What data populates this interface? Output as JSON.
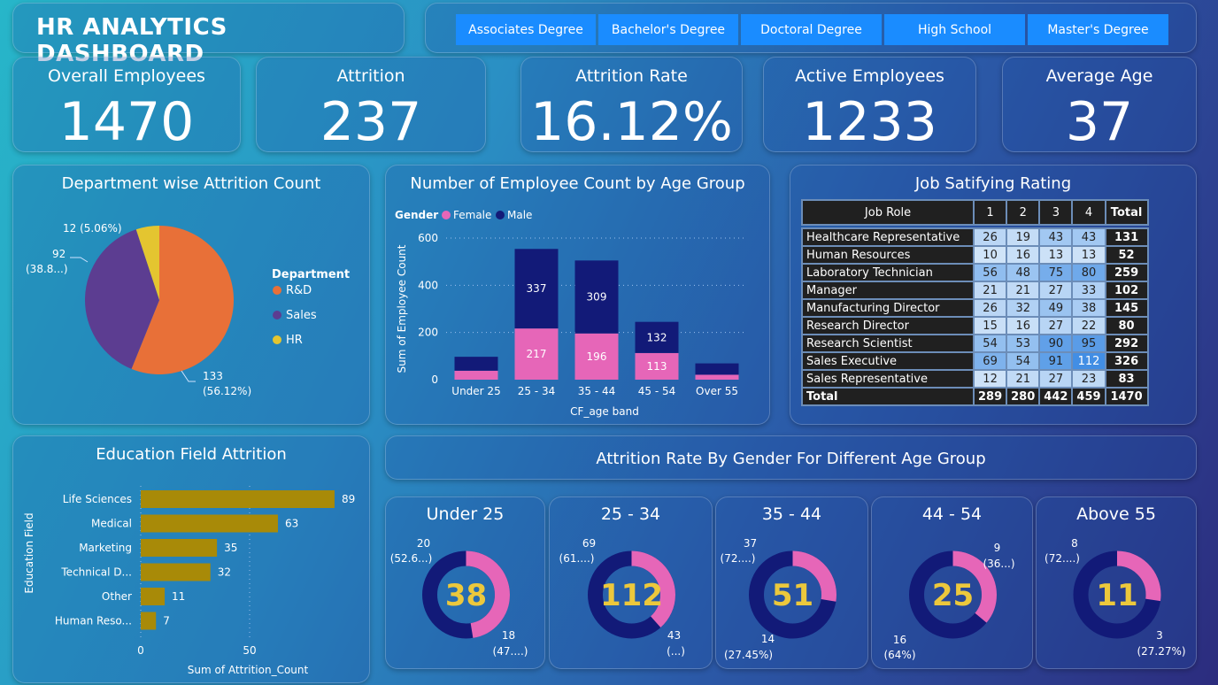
{
  "header": {
    "title": "HR ANALYTICS DASHBOARD"
  },
  "filters": [
    "Associates Degree",
    "Bachelor's Degree",
    "Doctoral Degree",
    "High School",
    "Master's Degree"
  ],
  "kpis": [
    {
      "label": "Overall Employees",
      "value": "1470"
    },
    {
      "label": "Attrition",
      "value": "237"
    },
    {
      "label": "Attrition Rate",
      "value": "16.12%"
    },
    {
      "label": "Active Employees",
      "value": "1233"
    },
    {
      "label": "Average Age",
      "value": "37"
    }
  ],
  "colors": {
    "rnd": "#e87038",
    "sales": "#5c3d91",
    "hr": "#e4c530",
    "female": "#e666b8",
    "male": "#121a78",
    "bar": "#a88a08",
    "donut_value": "#ecc83c",
    "filter": "#1a8cff"
  },
  "chart_data": [
    {
      "type": "pie",
      "title": "Department wise Attrition Count",
      "legend_title": "Department",
      "legend_position": "right",
      "slices": [
        {
          "name": "R&D",
          "value": 133,
          "label": "133",
          "pct": "(56.12%)"
        },
        {
          "name": "Sales",
          "value": 92,
          "label": "92",
          "pct": "(38.8...)"
        },
        {
          "name": "HR",
          "value": 12,
          "label": "12 (5.06%)",
          "pct": ""
        }
      ]
    },
    {
      "type": "bar",
      "stacked": true,
      "title": "Number of Employee Count by Age Group",
      "legend_title": "Gender",
      "legend_position": "top-left",
      "categories": [
        "Under 25",
        "25 - 34",
        "35 - 44",
        "45 - 54",
        "Over 55"
      ],
      "series": [
        {
          "name": "Female",
          "values": [
            38,
            217,
            196,
            113,
            21
          ]
        },
        {
          "name": "Male",
          "values": [
            59,
            337,
            309,
            132,
            48
          ]
        }
      ],
      "shown_labels": [
        {
          "series": 0,
          "index": 1,
          "text": "217"
        },
        {
          "series": 0,
          "index": 2,
          "text": "196"
        },
        {
          "series": 0,
          "index": 3,
          "text": "113"
        },
        {
          "series": 1,
          "index": 1,
          "text": "337"
        },
        {
          "series": 1,
          "index": 2,
          "text": "309"
        },
        {
          "series": 1,
          "index": 3,
          "text": "132"
        }
      ],
      "xlabel": "CF_age band",
      "ylabel": "Sum of Employee Count",
      "ylim": [
        0,
        600
      ],
      "yticks": [
        0,
        200,
        400,
        600
      ],
      "grid": true
    },
    {
      "type": "table",
      "title": "Job Satifying Rating",
      "columns": [
        "Job Role",
        "1",
        "2",
        "3",
        "4",
        "Total"
      ],
      "rows": [
        [
          "Healthcare Representative",
          26,
          19,
          43,
          43,
          131
        ],
        [
          "Human Resources",
          10,
          16,
          13,
          13,
          52
        ],
        [
          "Laboratory Technician",
          56,
          48,
          75,
          80,
          259
        ],
        [
          "Manager",
          21,
          21,
          27,
          33,
          102
        ],
        [
          "Manufacturing Director",
          26,
          32,
          49,
          38,
          145
        ],
        [
          "Research Director",
          15,
          16,
          27,
          22,
          80
        ],
        [
          "Research Scientist",
          54,
          53,
          90,
          95,
          292
        ],
        [
          "Sales Executive",
          69,
          54,
          91,
          112,
          326
        ],
        [
          "Sales Representative",
          12,
          21,
          27,
          23,
          83
        ]
      ],
      "total_row": [
        "Total",
        289,
        280,
        442,
        459,
        1470
      ]
    },
    {
      "type": "bar",
      "orientation": "horizontal",
      "title": "Education Field Attrition",
      "categories": [
        "Life Sciences",
        "Medical",
        "Marketing",
        "Technical D...",
        "Other",
        "Human Reso..."
      ],
      "values": [
        89,
        63,
        35,
        32,
        11,
        7
      ],
      "xlabel": "Sum of Attrition_Count",
      "ylabel": "Education Field",
      "xlim": [
        0,
        100
      ],
      "xticks": [
        0,
        50
      ]
    },
    {
      "type": "pie",
      "donut": true,
      "section_title": "Attrition Rate By Gender For Different Age Group",
      "donuts": [
        {
          "title": "Under 25",
          "total": "38",
          "female": 18,
          "male": 20,
          "male_label": "20",
          "male_pct": "(52.6...)",
          "female_label": "18",
          "female_pct": "(47....)"
        },
        {
          "title": "25 - 34",
          "total": "112",
          "female": 43,
          "male": 69,
          "male_label": "69",
          "male_pct": "(61....)",
          "female_label": "43",
          "female_pct": "(...)"
        },
        {
          "title": "35 - 44",
          "total": "51",
          "female": 14,
          "male": 37,
          "male_label": "37",
          "male_pct": "(72....)",
          "female_label": "14",
          "female_pct": "(27.45%)"
        },
        {
          "title": "44 - 54",
          "total": "25",
          "female": 9,
          "male": 16,
          "male_label": "16",
          "male_pct": "(64%)",
          "female_label": "9",
          "female_pct": "(36...)"
        },
        {
          "title": "Above 55",
          "total": "11",
          "female": 3,
          "male": 8,
          "male_label": "8",
          "male_pct": "(72....)",
          "female_label": "3",
          "female_pct": "(27.27%)"
        }
      ]
    }
  ]
}
